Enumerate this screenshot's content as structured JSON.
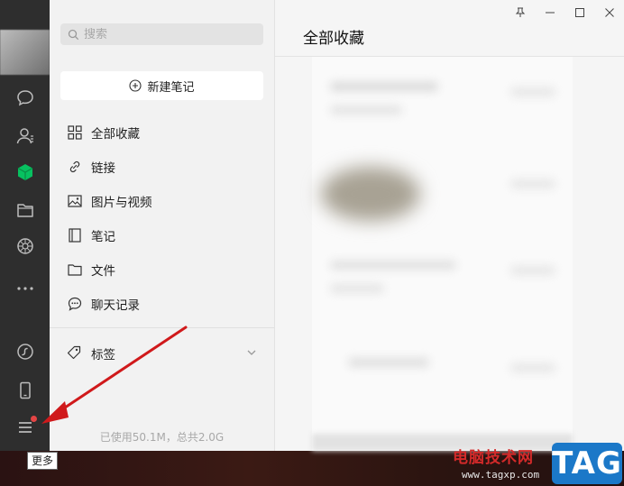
{
  "window": {
    "controls": [
      "pin-icon",
      "minimize-icon",
      "maximize-icon",
      "close-icon"
    ]
  },
  "sidebar": {
    "icons": [
      "chat-icon",
      "contacts-icon",
      "favorites-cube-icon",
      "folder-icon",
      "moments-aperture-icon",
      "more-dots-icon",
      "mini-program-icon",
      "phone-icon",
      "menu-icon"
    ],
    "active_color": "#07c160",
    "menu_tooltip": "更多"
  },
  "middle": {
    "search_placeholder": "搜索",
    "new_note_label": "新建笔记",
    "nav_items": [
      {
        "label": "全部收藏",
        "icon": "grid-icon"
      },
      {
        "label": "链接",
        "icon": "link-icon"
      },
      {
        "label": "图片与视频",
        "icon": "image-icon"
      },
      {
        "label": "笔记",
        "icon": "notebook-icon"
      },
      {
        "label": "文件",
        "icon": "folder-icon"
      },
      {
        "label": "聊天记录",
        "icon": "chat-bubble-icon"
      }
    ],
    "tags_label": "标签",
    "storage_text": "已使用50.1M，总共2.0G"
  },
  "content": {
    "title": "全部收藏"
  },
  "watermark": {
    "cn_text": "电脑技术网",
    "url": "www.tagxp.com",
    "tag": "TAG"
  },
  "colors": {
    "rail": "#2e2e2e",
    "panel": "#f2f2f2",
    "accent_red": "#e54545",
    "arrow": "#d0191b"
  }
}
